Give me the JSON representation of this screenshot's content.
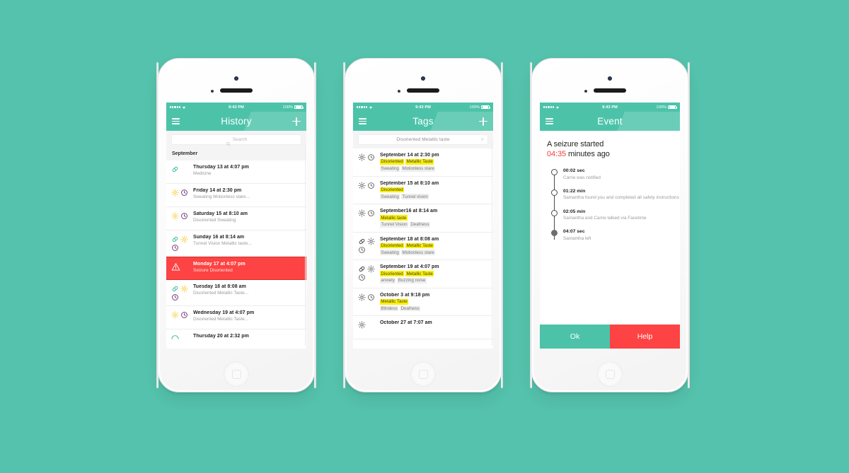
{
  "background_color": "#54c2ac",
  "accent_color": "#4cc3a9",
  "alert_color": "#fd4343",
  "highlight_color": "#fcf000",
  "statusbar": {
    "time": "9:43 PM",
    "battery_percent": "100%",
    "signal_icon": "signal-dots-icon",
    "wifi_icon": "wifi-icon",
    "battery_icon": "battery-icon"
  },
  "phones": [
    {
      "id": "history",
      "nav": {
        "title": "History",
        "menu_icon": "hamburger-menu-icon",
        "add_icon": "plus-icon"
      },
      "search": {
        "placeholder": "Search",
        "value": "",
        "icon": "search-icon"
      },
      "section_header": "September",
      "rows": [
        {
          "title": "Thursday 13  at 4:07 pm",
          "subtitle": "Medicine",
          "icons": [
            "pill-icon"
          ],
          "alert": false
        },
        {
          "title": "Friday 14  at 2:30 pm",
          "subtitle": "Sweating  Motionless stare...",
          "icons": [
            "sun-icon",
            "clock-icon"
          ],
          "alert": false
        },
        {
          "title": "Saturday 15  at 8:10 am",
          "subtitle": "Disoriented  Sweating",
          "icons": [
            "sun-icon",
            "clock-icon"
          ],
          "alert": false
        },
        {
          "title": "Sunday 16  at 8:14 am",
          "subtitle": "Tunnel Vision  Metallic taste...",
          "icons": [
            "pill-icon",
            "sun-icon",
            "clock-icon"
          ],
          "alert": false
        },
        {
          "title": "Monday 17  at 4:07 pm",
          "subtitle": "Seizure  Disoriented",
          "icons": [
            "warning-icon"
          ],
          "alert": true
        },
        {
          "title": "Tuesday 18  at 8:08 am",
          "subtitle": "Disoriented  Metallic Taste...",
          "icons": [
            "pill-icon",
            "sun-icon",
            "clock-icon"
          ],
          "alert": false
        },
        {
          "title": "Wednesday 19  at 4:07 pm",
          "subtitle": "Disoriented  Metallic Taste...",
          "icons": [
            "sun-icon",
            "clock-icon"
          ],
          "alert": false
        },
        {
          "title": "Thursday 20  at 2:32 pm",
          "subtitle": "",
          "icons": [
            "arc-icon"
          ],
          "alert": false
        }
      ]
    },
    {
      "id": "tags",
      "nav": {
        "title": "Tags",
        "menu_icon": "hamburger-menu-icon",
        "add_icon": "plus-icon"
      },
      "search": {
        "placeholder": "Search",
        "value": "Disoriented  Metallic taste",
        "clear_label": "×",
        "icon": "search-icon"
      },
      "rows": [
        {
          "title": "September 14  at 2:30 pm",
          "icons": [
            "sun-icon",
            "clock-icon"
          ],
          "tags": [
            {
              "label": "Disoriented",
              "highlighted": true
            },
            {
              "label": "Metallic Taste",
              "highlighted": true
            },
            {
              "label": "Sweating",
              "highlighted": false
            },
            {
              "label": "Motionless stare",
              "highlighted": false
            }
          ]
        },
        {
          "title": "September 15  at 8:10 am",
          "icons": [
            "sun-icon",
            "clock-icon"
          ],
          "tags": [
            {
              "label": "Disoriented",
              "highlighted": true
            },
            {
              "label": "Sweating",
              "highlighted": false
            },
            {
              "label": "Tunnel vision",
              "highlighted": false
            }
          ]
        },
        {
          "title": "September16  at 8:14 am",
          "icons": [
            "sun-icon",
            "clock-icon"
          ],
          "tags": [
            {
              "label": "Metallic taste",
              "highlighted": true
            },
            {
              "label": "Tunnel Vision",
              "highlighted": false
            },
            {
              "label": "Deafness",
              "highlighted": false
            }
          ]
        },
        {
          "title": "September 18  at 8:08 am",
          "icons": [
            "pill-icon",
            "sun-icon",
            "clock-icon"
          ],
          "tags": [
            {
              "label": "Disoriented",
              "highlighted": true
            },
            {
              "label": "Metallic Taste",
              "highlighted": true
            },
            {
              "label": "Sweating",
              "highlighted": false
            },
            {
              "label": "Motionless stare",
              "highlighted": false
            }
          ]
        },
        {
          "title": "September 19  at 4:07 pm",
          "icons": [
            "pill-icon",
            "sun-icon",
            "clock-icon"
          ],
          "tags": [
            {
              "label": "Disoriented",
              "highlighted": true
            },
            {
              "label": "Metallic Taste",
              "highlighted": true
            },
            {
              "label": "anxiety",
              "highlighted": false
            },
            {
              "label": "Buzzing noise",
              "highlighted": false
            }
          ]
        },
        {
          "title": "October 3  at 9:18 pm",
          "icons": [
            "sun-icon",
            "clock-icon"
          ],
          "tags": [
            {
              "label": "Metallic Taste",
              "highlighted": true
            },
            {
              "label": "Blindess",
              "highlighted": false
            },
            {
              "label": "Deafness",
              "highlighted": false
            }
          ]
        },
        {
          "title": "October 27  at 7:07 am",
          "icons": [
            "sun-icon"
          ],
          "tags": []
        }
      ]
    },
    {
      "id": "event",
      "nav": {
        "title": "Event",
        "menu_icon": "hamburger-menu-icon"
      },
      "headline_line1": "A seizure started",
      "headline_time": "04:35",
      "headline_line2_suffix": " minutes ago",
      "timeline": [
        {
          "time": "00:02 sec",
          "detail": "Carrie was notified",
          "filled": false
        },
        {
          "time": "01:22 min",
          "detail": "Samantha found you and completed all safety instructions",
          "filled": false
        },
        {
          "time": "02:05 min",
          "detail": "Samantha and Carrie talked via Facetime",
          "filled": false
        },
        {
          "time": "04:07 sec",
          "detail": "Samantha left",
          "filled": true
        }
      ],
      "actions": {
        "ok_label": "Ok",
        "help_label": "Help"
      }
    }
  ]
}
